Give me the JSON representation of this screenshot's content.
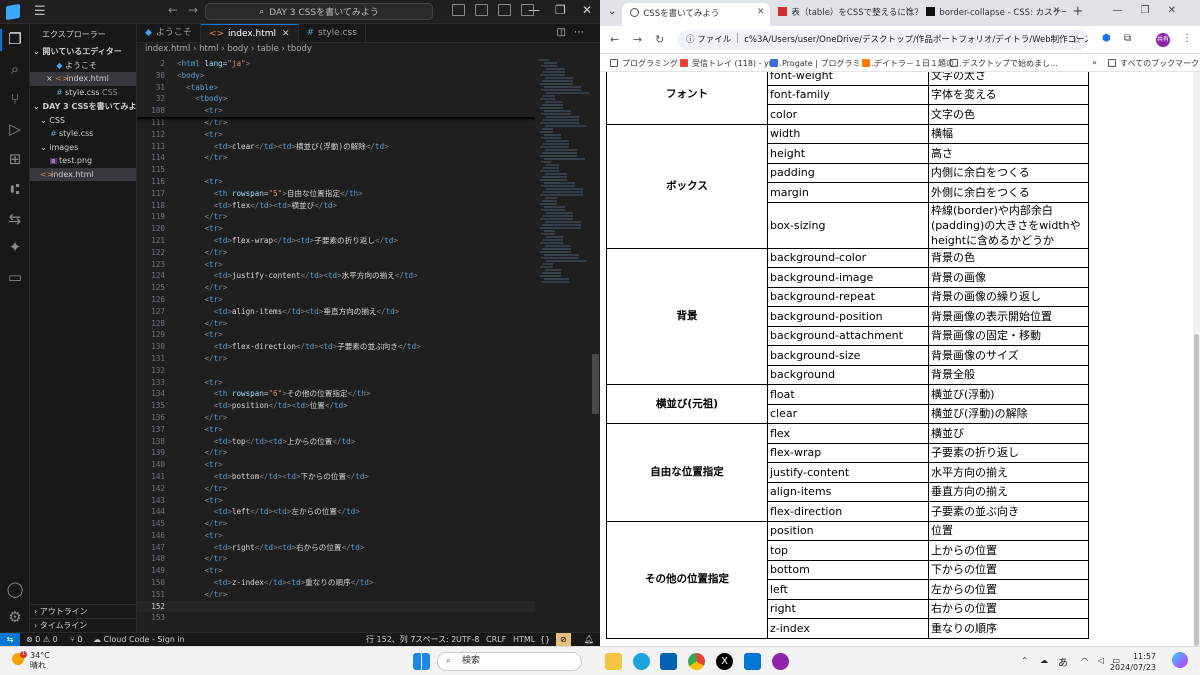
{
  "vscode": {
    "menu_icon": "hamburger-icon",
    "search_label": "DAY 3 CSSを書いてみよう",
    "explorer_title": "エクスプローラー",
    "open_editors_label": "開いているエディター",
    "open_editors": [
      {
        "name": "ようこそ",
        "icon": "vscode-welcome-icon"
      },
      {
        "name": "index.html",
        "icon": "html-file-icon",
        "prefix": "×"
      },
      {
        "name": "style.css",
        "suffix": "CSS",
        "icon": "css-file-icon"
      }
    ],
    "folder_label": "DAY 3 CSSを書いてみよう",
    "tree": [
      {
        "name": "CSS",
        "type": "folder"
      },
      {
        "name": "style.css",
        "type": "css"
      },
      {
        "name": "images",
        "type": "folder"
      },
      {
        "name": "test.png",
        "type": "image"
      },
      {
        "name": "index.html",
        "type": "html"
      }
    ],
    "outline_label": "アウトライン",
    "timeline_label": "タイムライン",
    "tabs": [
      {
        "label": "ようこそ"
      },
      {
        "label": "index.html"
      },
      {
        "label": "style.css"
      }
    ],
    "breadcrumb": [
      "index.html",
      "html",
      "body",
      "table",
      "tbody"
    ],
    "sticky_lines": [
      {
        "n": "2",
        "html": "<span class='br'>&lt;</span><span class='tg'>html</span> <span class='at'>lang</span><span class='tx'>=</span><span class='sv'>\"ja\"</span><span class='br'>&gt;</span>"
      },
      {
        "n": "30",
        "html": "<span class='br'>&lt;</span><span class='tg'>body</span><span class='br'>&gt;</span>"
      },
      {
        "n": "31",
        "html": "  <span class='br'>&lt;</span><span class='tg'>table</span><span class='br'>&gt;</span>"
      },
      {
        "n": "32",
        "html": "    <span class='br'>&lt;</span><span class='tg'>tbody</span><span class='br'>&gt;</span>"
      },
      {
        "n": "108",
        "html": "      <span class='br'>&lt;</span><span class='tg'>tr</span><span class='br'>&gt;</span>"
      }
    ],
    "code_lines": [
      {
        "n": "111",
        "html": "      <span class='br'>&lt;/</span><span class='tg'>tr</span><span class='br'>&gt;</span>"
      },
      {
        "n": "112",
        "html": "      <span class='br'>&lt;</span><span class='tg'>tr</span><span class='br'>&gt;</span>"
      },
      {
        "n": "113",
        "html": "        <span class='br'>&lt;</span><span class='tg'>td</span><span class='br'>&gt;</span><span class='tx'>clear</span><span class='br'>&lt;/</span><span class='tg'>td</span><span class='br'>&gt;&lt;</span><span class='tg'>td</span><span class='br'>&gt;</span><span class='tx'>横並び(浮動)の解除</span><span class='br'>&lt;/</span><span class='tg'>td</span><span class='br'>&gt;</span>"
      },
      {
        "n": "114",
        "html": "      <span class='br'>&lt;/</span><span class='tg'>tr</span><span class='br'>&gt;</span>"
      },
      {
        "n": "115",
        "html": ""
      },
      {
        "n": "116",
        "html": "      <span class='br'>&lt;</span><span class='tg'>tr</span><span class='br'>&gt;</span>"
      },
      {
        "n": "117",
        "html": "        <span class='br'>&lt;</span><span class='tg'>th</span> <span class='at'>rowspan</span><span class='tx'>=</span><span class='sv'>\"5\"</span><span class='br'>&gt;</span><span class='tx'>自由な位置指定</span><span class='br'>&lt;/</span><span class='tg'>th</span><span class='br'>&gt;</span>"
      },
      {
        "n": "118",
        "html": "        <span class='br'>&lt;</span><span class='tg'>td</span><span class='br'>&gt;</span><span class='tx'>flex</span><span class='br'>&lt;/</span><span class='tg'>td</span><span class='br'>&gt;&lt;</span><span class='tg'>td</span><span class='br'>&gt;</span><span class='tx'>横並び</span><span class='br'>&lt;/</span><span class='tg'>td</span><span class='br'>&gt;</span>"
      },
      {
        "n": "119",
        "html": "      <span class='br'>&lt;/</span><span class='tg'>tr</span><span class='br'>&gt;</span>"
      },
      {
        "n": "120",
        "html": "      <span class='br'>&lt;</span><span class='tg'>tr</span><span class='br'>&gt;</span>"
      },
      {
        "n": "121",
        "html": "        <span class='br'>&lt;</span><span class='tg'>td</span><span class='br'>&gt;</span><span class='tx'>flex-wrap</span><span class='br'>&lt;/</span><span class='tg'>td</span><span class='br'>&gt;&lt;</span><span class='tg'>td</span><span class='br'>&gt;</span><span class='tx'>子要素の折り返し</span><span class='br'>&lt;/</span><span class='tg'>td</span><span class='br'>&gt;</span>"
      },
      {
        "n": "122",
        "html": "      <span class='br'>&lt;/</span><span class='tg'>tr</span><span class='br'>&gt;</span>"
      },
      {
        "n": "123",
        "html": "      <span class='br'>&lt;</span><span class='tg'>tr</span><span class='br'>&gt;</span>"
      },
      {
        "n": "124",
        "html": "        <span class='br'>&lt;</span><span class='tg'>td</span><span class='br'>&gt;</span><span class='tx'>justify-content</span><span class='br'>&lt;/</span><span class='tg'>td</span><span class='br'>&gt;&lt;</span><span class='tg'>td</span><span class='br'>&gt;</span><span class='tx'>水平方向の揃え</span><span class='br'>&lt;/</span><span class='tg'>td</span><span class='br'>&gt;</span>"
      },
      {
        "n": "125",
        "html": "      <span class='br'>&lt;/</span><span class='tg'>tr</span><span class='br'>&gt;</span>"
      },
      {
        "n": "126",
        "html": "      <span class='br'>&lt;</span><span class='tg'>tr</span><span class='br'>&gt;</span>"
      },
      {
        "n": "127",
        "html": "        <span class='br'>&lt;</span><span class='tg'>td</span><span class='br'>&gt;</span><span class='tx'>align-items</span><span class='br'>&lt;/</span><span class='tg'>td</span><span class='br'>&gt;&lt;</span><span class='tg'>td</span><span class='br'>&gt;</span><span class='tx'>垂直方向の揃え</span><span class='br'>&lt;/</span><span class='tg'>td</span><span class='br'>&gt;</span>"
      },
      {
        "n": "128",
        "html": "      <span class='br'>&lt;/</span><span class='tg'>tr</span><span class='br'>&gt;</span>"
      },
      {
        "n": "129",
        "html": "      <span class='br'>&lt;</span><span class='tg'>tr</span><span class='br'>&gt;</span>"
      },
      {
        "n": "130",
        "html": "        <span class='br'>&lt;</span><span class='tg'>td</span><span class='br'>&gt;</span><span class='tx'>flex-direction</span><span class='br'>&lt;/</span><span class='tg'>td</span><span class='br'>&gt;&lt;</span><span class='tg'>td</span><span class='br'>&gt;</span><span class='tx'>子要素の並ぶ向き</span><span class='br'>&lt;/</span><span class='tg'>td</span><span class='br'>&gt;</span>"
      },
      {
        "n": "131",
        "html": "      <span class='br'>&lt;/</span><span class='tg'>tr</span><span class='br'>&gt;</span>"
      },
      {
        "n": "132",
        "html": ""
      },
      {
        "n": "133",
        "html": "      <span class='br'>&lt;</span><span class='tg'>tr</span><span class='br'>&gt;</span>"
      },
      {
        "n": "134",
        "html": "        <span class='br'>&lt;</span><span class='tg'>th</span> <span class='at'>rowspan</span><span class='tx'>=</span><span class='sv'>\"6\"</span><span class='br'>&gt;</span><span class='tx'>その他の位置指定</span><span class='br'>&lt;/</span><span class='tg'>th</span><span class='br'>&gt;</span>"
      },
      {
        "n": "135",
        "html": "        <span class='br'>&lt;</span><span class='tg'>td</span><span class='br'>&gt;</span><span class='tx'>position</span><span class='br'>&lt;/</span><span class='tg'>td</span><span class='br'>&gt;&lt;</span><span class='tg'>td</span><span class='br'>&gt;</span><span class='tx'>位置</span><span class='br'>&lt;/</span><span class='tg'>td</span><span class='br'>&gt;</span>"
      },
      {
        "n": "136",
        "html": "      <span class='br'>&lt;/</span><span class='tg'>tr</span><span class='br'>&gt;</span>"
      },
      {
        "n": "137",
        "html": "      <span class='br'>&lt;</span><span class='tg'>tr</span><span class='br'>&gt;</span>"
      },
      {
        "n": "138",
        "html": "        <span class='br'>&lt;</span><span class='tg'>td</span><span class='br'>&gt;</span><span class='tx'>top</span><span class='br'>&lt;/</span><span class='tg'>td</span><span class='br'>&gt;&lt;</span><span class='tg'>td</span><span class='br'>&gt;</span><span class='tx'>上からの位置</span><span class='br'>&lt;/</span><span class='tg'>td</span><span class='br'>&gt;</span>"
      },
      {
        "n": "139",
        "html": "      <span class='br'>&lt;/</span><span class='tg'>tr</span><span class='br'>&gt;</span>"
      },
      {
        "n": "140",
        "html": "      <span class='br'>&lt;</span><span class='tg'>tr</span><span class='br'>&gt;</span>"
      },
      {
        "n": "141",
        "html": "        <span class='br'>&lt;</span><span class='tg'>td</span><span class='br'>&gt;</span><span class='tx'>bottom</span><span class='br'>&lt;/</span><span class='tg'>td</span><span class='br'>&gt;&lt;</span><span class='tg'>td</span><span class='br'>&gt;</span><span class='tx'>下からの位置</span><span class='br'>&lt;/</span><span class='tg'>td</span><span class='br'>&gt;</span>"
      },
      {
        "n": "142",
        "html": "      <span class='br'>&lt;/</span><span class='tg'>tr</span><span class='br'>&gt;</span>"
      },
      {
        "n": "143",
        "html": "      <span class='br'>&lt;</span><span class='tg'>tr</span><span class='br'>&gt;</span>"
      },
      {
        "n": "144",
        "html": "        <span class='br'>&lt;</span><span class='tg'>td</span><span class='br'>&gt;</span><span class='tx'>left</span><span class='br'>&lt;/</span><span class='tg'>td</span><span class='br'>&gt;&lt;</span><span class='tg'>td</span><span class='br'>&gt;</span><span class='tx'>左からの位置</span><span class='br'>&lt;/</span><span class='tg'>td</span><span class='br'>&gt;</span>"
      },
      {
        "n": "145",
        "html": "      <span class='br'>&lt;/</span><span class='tg'>tr</span><span class='br'>&gt;</span>"
      },
      {
        "n": "146",
        "html": "      <span class='br'>&lt;</span><span class='tg'>tr</span><span class='br'>&gt;</span>"
      },
      {
        "n": "147",
        "html": "        <span class='br'>&lt;</span><span class='tg'>td</span><span class='br'>&gt;</span><span class='tx'>right</span><span class='br'>&lt;/</span><span class='tg'>td</span><span class='br'>&gt;&lt;</span><span class='tg'>td</span><span class='br'>&gt;</span><span class='tx'>右からの位置</span><span class='br'>&lt;/</span><span class='tg'>td</span><span class='br'>&gt;</span>"
      },
      {
        "n": "148",
        "html": "      <span class='br'>&lt;/</span><span class='tg'>tr</span><span class='br'>&gt;</span>"
      },
      {
        "n": "149",
        "html": "      <span class='br'>&lt;</span><span class='tg'>tr</span><span class='br'>&gt;</span>"
      },
      {
        "n": "150",
        "html": "        <span class='br'>&lt;</span><span class='tg'>td</span><span class='br'>&gt;</span><span class='tx'>z-index</span><span class='br'>&lt;/</span><span class='tg'>td</span><span class='br'>&gt;&lt;</span><span class='tg'>td</span><span class='br'>&gt;</span><span class='tx'>重なりの順序</span><span class='br'>&lt;/</span><span class='tg'>td</span><span class='br'>&gt;</span>"
      },
      {
        "n": "151",
        "html": "      <span class='br'>&lt;/</span><span class='tg'>tr</span><span class='br'>&gt;</span>"
      },
      {
        "n": "152",
        "html": "",
        "current": true
      },
      {
        "n": "153",
        "html": ""
      }
    ],
    "status": {
      "problems": "⊗ 0 ⚠ 0",
      "ports": "⑂ 0",
      "cloud": "Cloud Code - Sign in",
      "cursor": "行 152、列 7",
      "spaces": "スペース: 2",
      "encoding": "UTF-8",
      "eol": "CRLF",
      "language": "HTML"
    }
  },
  "chrome": {
    "tabs": [
      {
        "label": "CSSを書いてみよう",
        "icon": "globe-icon",
        "active": true
      },
      {
        "label": "表（table）をCSSで整えるには？",
        "icon": "bookmark-red-icon"
      },
      {
        "label": "border-collapse - CSS: カスケー",
        "icon": "mdn-icon"
      }
    ],
    "address": {
      "scheme": "ファイル",
      "url": "c%3A/Users/user/OneDrive/デスクトップ/作品ポートフォリオ/デイトラ/Web制作コース/DAY%20..."
    },
    "bookmarks": [
      {
        "label": "プログラミング",
        "icon": "folder-icon"
      },
      {
        "label": "受信トレイ (118) - y0...",
        "icon": "gmail-icon"
      },
      {
        "label": "Progate | プログラミン...",
        "icon": "progate-icon"
      },
      {
        "label": "デイトラ－１日１題の...",
        "icon": "daytra-icon"
      },
      {
        "label": "デスクトップで始めまし...",
        "icon": "doc-icon"
      }
    ],
    "all_bookmarks": "すべてのブックマーク",
    "avatar_text": "共有",
    "table": [
      {
        "group": "フォント",
        "rows": [
          [
            "font-weight",
            "文字の太さ"
          ],
          [
            "font-family",
            "字体を変える"
          ],
          [
            "color",
            "文字の色"
          ]
        ]
      },
      {
        "group": "ボックス",
        "rows": [
          [
            "width",
            "横幅"
          ],
          [
            "height",
            "高さ"
          ],
          [
            "padding",
            "内側に余白をつくる"
          ],
          [
            "margin",
            "外側に余白をつくる"
          ],
          [
            "box-sizing",
            "枠線(border)や内部余白(padding)の大きさをwidthやheightに含めるかどうか"
          ]
        ]
      },
      {
        "group": "背景",
        "rows": [
          [
            "background-color",
            "背景の色"
          ],
          [
            "background-image",
            "背景の画像"
          ],
          [
            "background-repeat",
            "背景の画像の繰り返し"
          ],
          [
            "background-position",
            "背景画像の表示開始位置"
          ],
          [
            "background-attachment",
            "背景画像の固定・移動"
          ],
          [
            "background-size",
            "背景画像のサイズ"
          ],
          [
            "background",
            "背景全般"
          ]
        ]
      },
      {
        "group": "横並び(元祖)",
        "rows": [
          [
            "float",
            "横並び(浮動)"
          ],
          [
            "clear",
            "横並び(浮動)の解除"
          ]
        ]
      },
      {
        "group": "自由な位置指定",
        "rows": [
          [
            "flex",
            "横並び"
          ],
          [
            "flex-wrap",
            "子要素の折り返し"
          ],
          [
            "justify-content",
            "水平方向の揃え"
          ],
          [
            "align-items",
            "垂直方向の揃え"
          ],
          [
            "flex-direction",
            "子要素の並ぶ向き"
          ]
        ]
      },
      {
        "group": "その他の位置指定",
        "rows": [
          [
            "position",
            "位置"
          ],
          [
            "top",
            "上からの位置"
          ],
          [
            "bottom",
            "下からの位置"
          ],
          [
            "left",
            "左からの位置"
          ],
          [
            "right",
            "右からの位置"
          ],
          [
            "z-index",
            "重なりの順序"
          ]
        ]
      }
    ]
  },
  "taskbar": {
    "weather_temp": "34°C",
    "weather_desc": "晴れ",
    "weather_badge": "1",
    "search_placeholder": "検索",
    "ime": "あ",
    "time": "11:57",
    "date": "2024/07/23"
  },
  "colors": {
    "vs_accent": "#0078d4",
    "vs_bg": "#1e1e1e",
    "html_tag": "#569cd6",
    "attr": "#9cdcfe",
    "string": "#ce9178"
  }
}
